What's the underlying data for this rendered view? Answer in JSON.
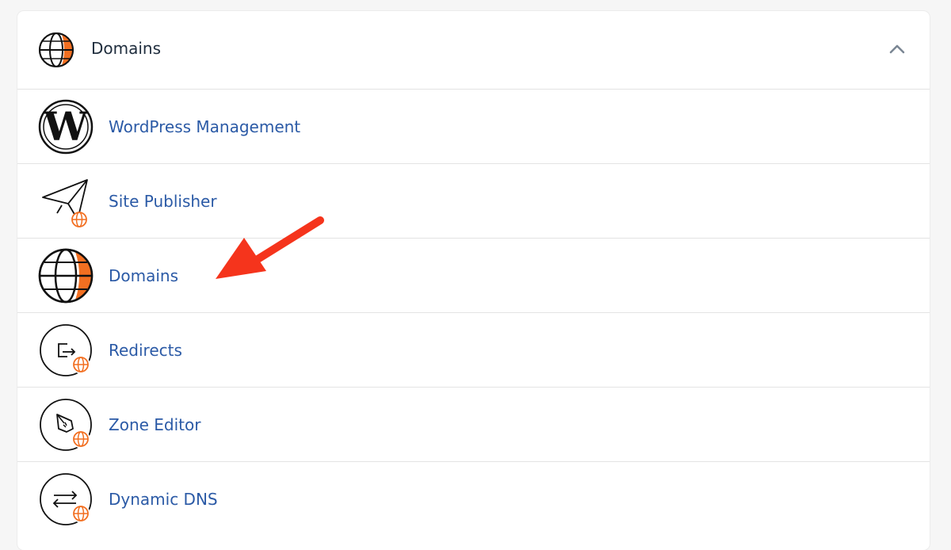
{
  "section": {
    "title": "Domains",
    "header_icon": "globe-icon",
    "toggle_icon": "chevron-up-icon"
  },
  "items": [
    {
      "label": "WordPress Management",
      "icon": "wordpress-icon"
    },
    {
      "label": "Site Publisher",
      "icon": "paper-plane-globe-icon"
    },
    {
      "label": "Domains",
      "icon": "globe-icon"
    },
    {
      "label": "Redirects",
      "icon": "redirect-globe-icon"
    },
    {
      "label": "Zone Editor",
      "icon": "pen-nib-globe-icon"
    },
    {
      "label": "Dynamic DNS",
      "icon": "arrows-exchange-globe-icon"
    }
  ],
  "colors": {
    "accent_orange": "#f26f21",
    "link_blue": "#2b5aa6",
    "annotation_red": "#f5341c"
  }
}
